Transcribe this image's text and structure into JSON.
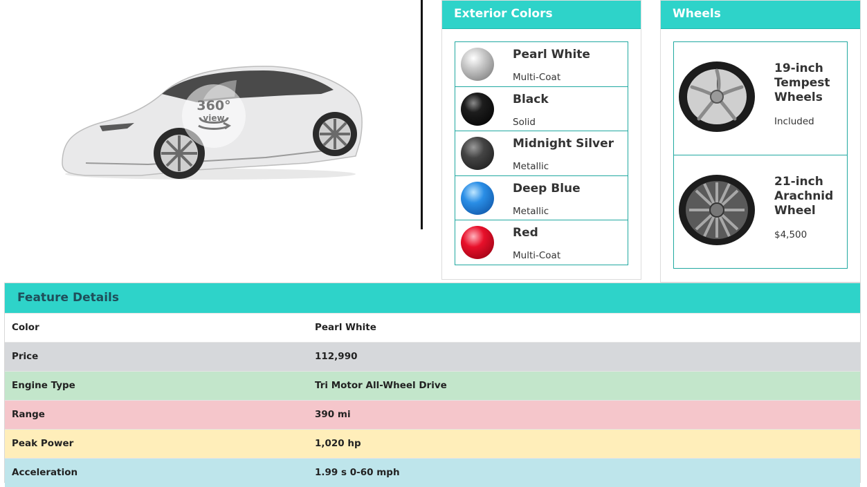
{
  "viewer": {
    "badge_big": "360°",
    "badge_small": "view"
  },
  "colors_panel": {
    "title": "Exterior Colors",
    "items": [
      {
        "name": "Pearl White",
        "finish": "Multi-Coat",
        "swatch": "#c8c8c8"
      },
      {
        "name": "Black",
        "finish": "Solid",
        "swatch": "#111111"
      },
      {
        "name": "Midnight Silver",
        "finish": "Metallic",
        "swatch": "#3a3a3a"
      },
      {
        "name": "Deep Blue",
        "finish": "Metallic",
        "swatch": "#1a7fd8"
      },
      {
        "name": "Red",
        "finish": "Multi-Coat",
        "swatch": "#e0102a"
      }
    ]
  },
  "wheels_panel": {
    "title": "Wheels",
    "items": [
      {
        "name": "19-inch Tempest Wheels",
        "price": "Included"
      },
      {
        "name": "21-inch Arachnid Wheel",
        "price": "$4,500"
      }
    ]
  },
  "details": {
    "title": "Feature Details",
    "rows": [
      {
        "label": "Color",
        "value": "Pearl White"
      },
      {
        "label": "Price",
        "value": "112,990"
      },
      {
        "label": "Engine Type",
        "value": "Tri Motor All-Wheel Drive"
      },
      {
        "label": "Range",
        "value": "390 mi"
      },
      {
        "label": "Peak Power",
        "value": "1,020 hp"
      },
      {
        "label": "Acceleration",
        "value": "1.99 s 0-60 mph"
      }
    ]
  },
  "theme": {
    "accent": "#2ed3c9",
    "border": "#1fa8a0"
  }
}
